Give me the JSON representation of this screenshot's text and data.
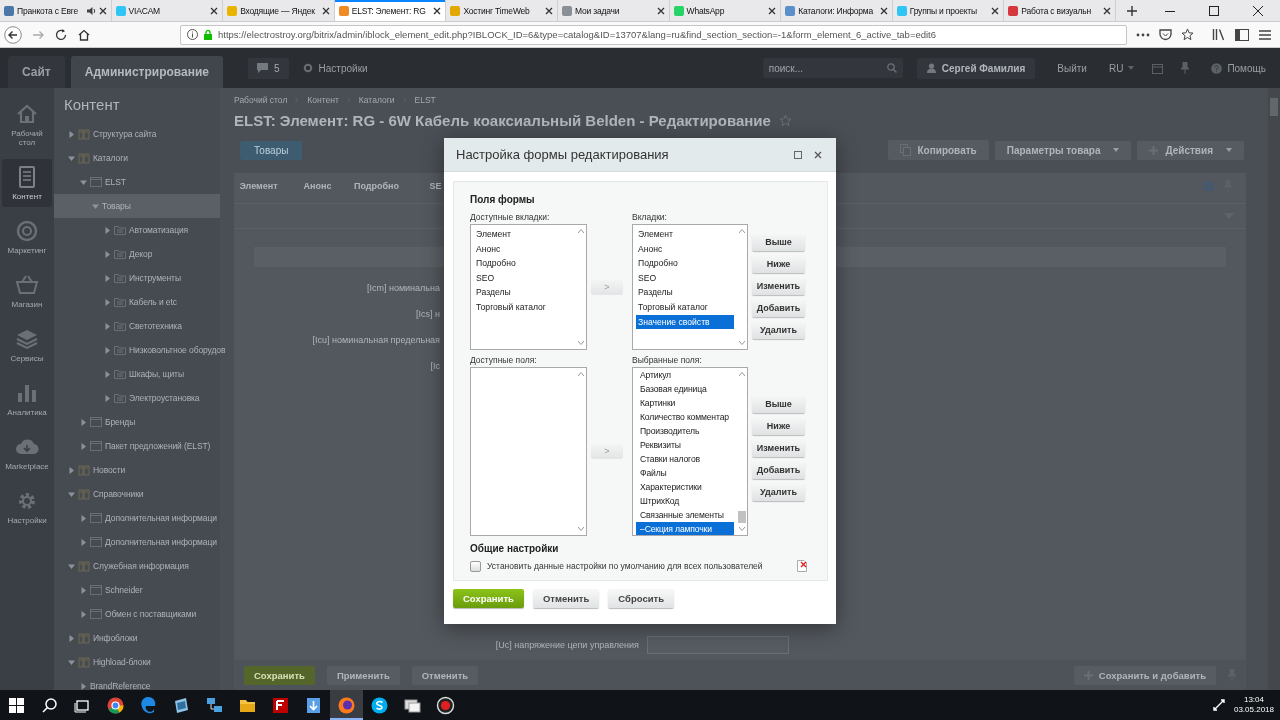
{
  "browser": {
    "tabs": [
      {
        "title": "Пранкота с Евге",
        "color": "#4a76a8",
        "selected": false,
        "audio": true
      },
      {
        "title": "VIACAM",
        "color": "#2fc6f6",
        "selected": false,
        "audio": false
      },
      {
        "title": "Входящие — Яндек",
        "color": "#e8b400",
        "selected": false,
        "audio": false
      },
      {
        "title": "ELST: Элемент: RG",
        "color": "#f08a24",
        "selected": true,
        "audio": false
      },
      {
        "title": "Хостинг TimeWeb",
        "color": "#e0a800",
        "selected": false,
        "audio": false
      },
      {
        "title": "Мои задачи",
        "color": "#8a8f96",
        "selected": false,
        "audio": false
      },
      {
        "title": "WhatsApp",
        "color": "#25d366",
        "selected": false,
        "audio": false
      },
      {
        "title": "Каталоги: Информа",
        "color": "#5b8fc9",
        "selected": false,
        "audio": false
      },
      {
        "title": "Группы и проекты",
        "color": "#2fc6f6",
        "selected": false,
        "audio": false
      },
      {
        "title": "Работа с визуальн",
        "color": "#d6373d",
        "selected": false,
        "audio": false
      }
    ],
    "url": "https://electrostroy.org/bitrix/admin/iblock_element_edit.php?IBLOCK_ID=6&type=catalog&ID=13707&lang=ru&find_section_section=-1&form_element_6_active_tab=edit6"
  },
  "admin": {
    "site_tabs": [
      {
        "label": "Сайт",
        "selected": false
      },
      {
        "label": "Администрирование",
        "selected": true
      }
    ],
    "notifications": "5",
    "settings": "Настройки",
    "search": {
      "placeholder": "поиск..."
    },
    "user": "Сергей Фамилия",
    "logout": "Выйти",
    "language": "RU",
    "help": "Помощь"
  },
  "sidebar": {
    "items": [
      {
        "label": "Рабочий стол",
        "selected": false
      },
      {
        "label": "Контент",
        "selected": true
      },
      {
        "label": "Маркетинг",
        "selected": false
      },
      {
        "label": "Магазин",
        "selected": false
      },
      {
        "label": "Сервисы",
        "selected": false
      },
      {
        "label": "Аналитика",
        "selected": false
      },
      {
        "label": "Marketplace",
        "selected": false
      },
      {
        "label": "Настройки",
        "selected": false
      }
    ]
  },
  "tree": {
    "title": "Контент",
    "items": [
      {
        "label": "Структура сайта",
        "kind": "type",
        "expanded": false,
        "selected": false
      },
      {
        "label": "Каталоги",
        "kind": "type",
        "expanded": true,
        "selected": false,
        "children": [
          {
            "label": "ELST",
            "kind": "iblock",
            "expanded": true,
            "selected": false,
            "children": [
              {
                "label": "Товары",
                "expanded": true,
                "selected": true,
                "children": [
                  {
                    "label": "Автоматизация",
                    "kind": "section",
                    "expanded": false,
                    "selected": false
                  },
                  {
                    "label": "Декор",
                    "kind": "section",
                    "expanded": false,
                    "selected": false
                  },
                  {
                    "label": "Инструменты",
                    "kind": "section",
                    "expanded": false,
                    "selected": false
                  },
                  {
                    "label": "Кабель и etc",
                    "kind": "section",
                    "expanded": false,
                    "selected": false
                  },
                  {
                    "label": "Светотехника",
                    "kind": "section",
                    "expanded": false,
                    "selected": false
                  },
                  {
                    "label": "Низковольтное оборудов",
                    "kind": "section",
                    "expanded": false,
                    "selected": false
                  },
                  {
                    "label": "Шкафы, щиты",
                    "kind": "section",
                    "expanded": false,
                    "selected": false
                  },
                  {
                    "label": "Электроустановка",
                    "kind": "section",
                    "expanded": false,
                    "selected": false
                  }
                ]
              }
            ]
          },
          {
            "label": "Бренды",
            "kind": "iblock",
            "expanded": false,
            "selected": false
          },
          {
            "label": "Пакет предложений (ELST)",
            "kind": "iblock",
            "expanded": false,
            "selected": false
          }
        ]
      },
      {
        "label": "Новости",
        "kind": "type",
        "expanded": false,
        "selected": false
      },
      {
        "label": "Справочники",
        "kind": "type",
        "expanded": true,
        "selected": false,
        "children": [
          {
            "label": "Дополнительная информаци",
            "kind": "iblock",
            "expanded": false,
            "selected": false
          },
          {
            "label": "Дополнительная информаци",
            "kind": "iblock",
            "expanded": false,
            "selected": false
          }
        ]
      },
      {
        "label": "Служебная информация",
        "kind": "type",
        "expanded": true,
        "selected": false,
        "children": [
          {
            "label": "Schneider",
            "kind": "iblock",
            "expanded": false,
            "selected": false
          },
          {
            "label": "Обмен с поставщиками",
            "kind": "iblock",
            "expanded": false,
            "selected": false
          }
        ]
      },
      {
        "label": "Инфоблоки",
        "kind": "type",
        "expanded": false,
        "selected": false
      },
      {
        "label": "Highload-блоки",
        "kind": "type",
        "expanded": true,
        "selected": false,
        "children": [
          {
            "label": "BrandReference",
            "expanded": false,
            "selected": false
          }
        ]
      }
    ]
  },
  "page": {
    "breadcrumbs": [
      "Рабочий стол",
      "Контент",
      "Каталоги",
      "ELST"
    ],
    "title": "ELST: Элемент: RG - 6W Кабель коаксиальный Belden - Редактирование",
    "back_button": "Товары",
    "actions": [
      {
        "label": "Копировать",
        "kind": "copy"
      },
      {
        "label": "Параметры товара",
        "kind": "menu"
      },
      {
        "label": "Действия",
        "kind": "add-menu"
      }
    ],
    "form_tabs": [
      "Элемент",
      "Анонс",
      "Подробно",
      "SE"
    ],
    "fields": [
      {
        "kind": "label",
        "label": "[Icm] номинальна"
      },
      {
        "kind": "label",
        "label": "[Ics] н"
      },
      {
        "kind": "label",
        "label": "[Icu] номинальная предельная"
      },
      {
        "kind": "label",
        "label": "[Ic"
      },
      {
        "kind": "field",
        "label": "[Uc] напряжение цепи управления"
      }
    ],
    "footer_buttons": [
      {
        "label": "Сохранить",
        "kind": "primary"
      },
      {
        "label": "Применить",
        "kind": "default"
      },
      {
        "label": "Отменить",
        "kind": "default"
      }
    ],
    "save_add": "Сохранить и добавить"
  },
  "dialog": {
    "title": "Настройка формы редактирования",
    "section": "Поля формы",
    "available_tabs": {
      "label": "Доступные вкладки:",
      "items": [
        {
          "text": "Элемент",
          "selected": false
        },
        {
          "text": "Анонс",
          "selected": false
        },
        {
          "text": "Подробно",
          "selected": false
        },
        {
          "text": "SEO",
          "selected": false
        },
        {
          "text": "Разделы",
          "selected": false
        },
        {
          "text": "Торговый каталог",
          "selected": false
        }
      ]
    },
    "add_tab_button": ">",
    "tabs": {
      "label": "Вкладки:",
      "items": [
        {
          "text": "Элемент",
          "selected": false
        },
        {
          "text": "Анонс",
          "selected": false
        },
        {
          "text": "Подробно",
          "selected": false
        },
        {
          "text": "SEO",
          "selected": false
        },
        {
          "text": "Разделы",
          "selected": false
        },
        {
          "text": "Торговый каталог",
          "selected": false
        },
        {
          "text": "Значение свойств",
          "selected": true
        }
      ]
    },
    "tab_buttons": [
      "Выше",
      "Ниже",
      "Изменить",
      "Добавить",
      "Удалить"
    ],
    "available_fields": {
      "label": "Доступные поля:"
    },
    "add_field_button": ">",
    "fields": {
      "label": "Выбранные поля:",
      "items": [
        {
          "text": "Артикул",
          "selected": false
        },
        {
          "text": "Базовая единица",
          "selected": false
        },
        {
          "text": "Картинки",
          "selected": false
        },
        {
          "text": "Количество комментар",
          "selected": false
        },
        {
          "text": "Производитель",
          "selected": false
        },
        {
          "text": "Реквизиты",
          "selected": false
        },
        {
          "text": "Ставки налогов",
          "selected": false
        },
        {
          "text": "Файлы",
          "selected": false
        },
        {
          "text": "Характеристики",
          "selected": false
        },
        {
          "text": "ШтрихКод",
          "selected": false
        },
        {
          "text": "Связанные элементы",
          "selected": false
        },
        {
          "text": "–Секция лампочки",
          "selected": true
        }
      ]
    },
    "field_buttons": [
      "Выше",
      "Ниже",
      "Изменить",
      "Добавить",
      "Удалить"
    ],
    "general": "Общие настройки",
    "default_for_all": {
      "label": "Установить данные настройки по умолчанию для всех пользователей",
      "checked": false
    },
    "buttons": [
      {
        "label": "Сохранить",
        "kind": "primary"
      },
      {
        "label": "Отменить",
        "kind": "default"
      },
      {
        "label": "Сбросить",
        "kind": "default"
      }
    ]
  },
  "taskbar": {
    "apps": [
      {
        "kind": "start",
        "active": false
      },
      {
        "kind": "search",
        "active": false
      },
      {
        "kind": "taskview",
        "active": false
      },
      {
        "kind": "chrome",
        "active": false
      },
      {
        "kind": "edge",
        "active": false
      },
      {
        "kind": "tile",
        "active": false
      },
      {
        "kind": "network",
        "active": false
      },
      {
        "kind": "folder",
        "active": false
      },
      {
        "kind": "ftp",
        "active": false
      },
      {
        "kind": "download",
        "active": false
      },
      {
        "kind": "firefox",
        "active": true
      },
      {
        "kind": "skype",
        "active": false
      },
      {
        "kind": "windows",
        "active": false
      },
      {
        "kind": "record",
        "active": false
      }
    ],
    "time": "13:04",
    "date": "03.05.2018"
  }
}
